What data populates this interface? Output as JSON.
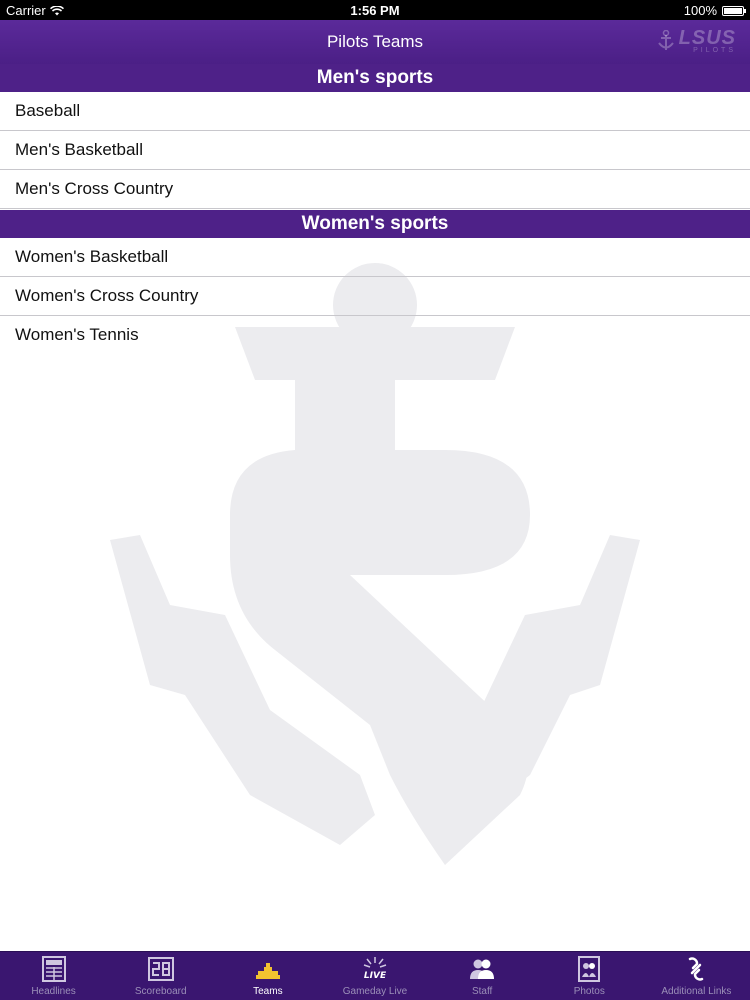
{
  "status_bar": {
    "carrier": "Carrier",
    "time": "1:56 PM",
    "battery": "100%"
  },
  "nav": {
    "title": "Pilots Teams",
    "logo_text": "LSUS",
    "logo_sub": "PILOTS"
  },
  "sections": [
    {
      "header": "Men's sports",
      "items": [
        "Baseball",
        "Men's Basketball",
        "Men's Cross Country"
      ]
    },
    {
      "header": "Women's sports",
      "items": [
        "Women's Basketball",
        "Women's Cross Country",
        "Women's Tennis"
      ]
    }
  ],
  "tabs": [
    {
      "label": "Headlines",
      "icon": "newspaper-icon",
      "active": false
    },
    {
      "label": "Scoreboard",
      "icon": "scoreboard-icon",
      "active": false
    },
    {
      "label": "Teams",
      "icon": "teams-icon",
      "active": true
    },
    {
      "label": "Gameday Live",
      "icon": "live-icon",
      "active": false
    },
    {
      "label": "Staff",
      "icon": "staff-icon",
      "active": false
    },
    {
      "label": "Photos",
      "icon": "photos-icon",
      "active": false
    },
    {
      "label": "Additional Links",
      "icon": "links-icon",
      "active": false
    }
  ],
  "colors": {
    "brand_purple": "#4e2188",
    "tab_active_gold": "#f2c230",
    "tab_inactive": "#9b8fb8"
  }
}
